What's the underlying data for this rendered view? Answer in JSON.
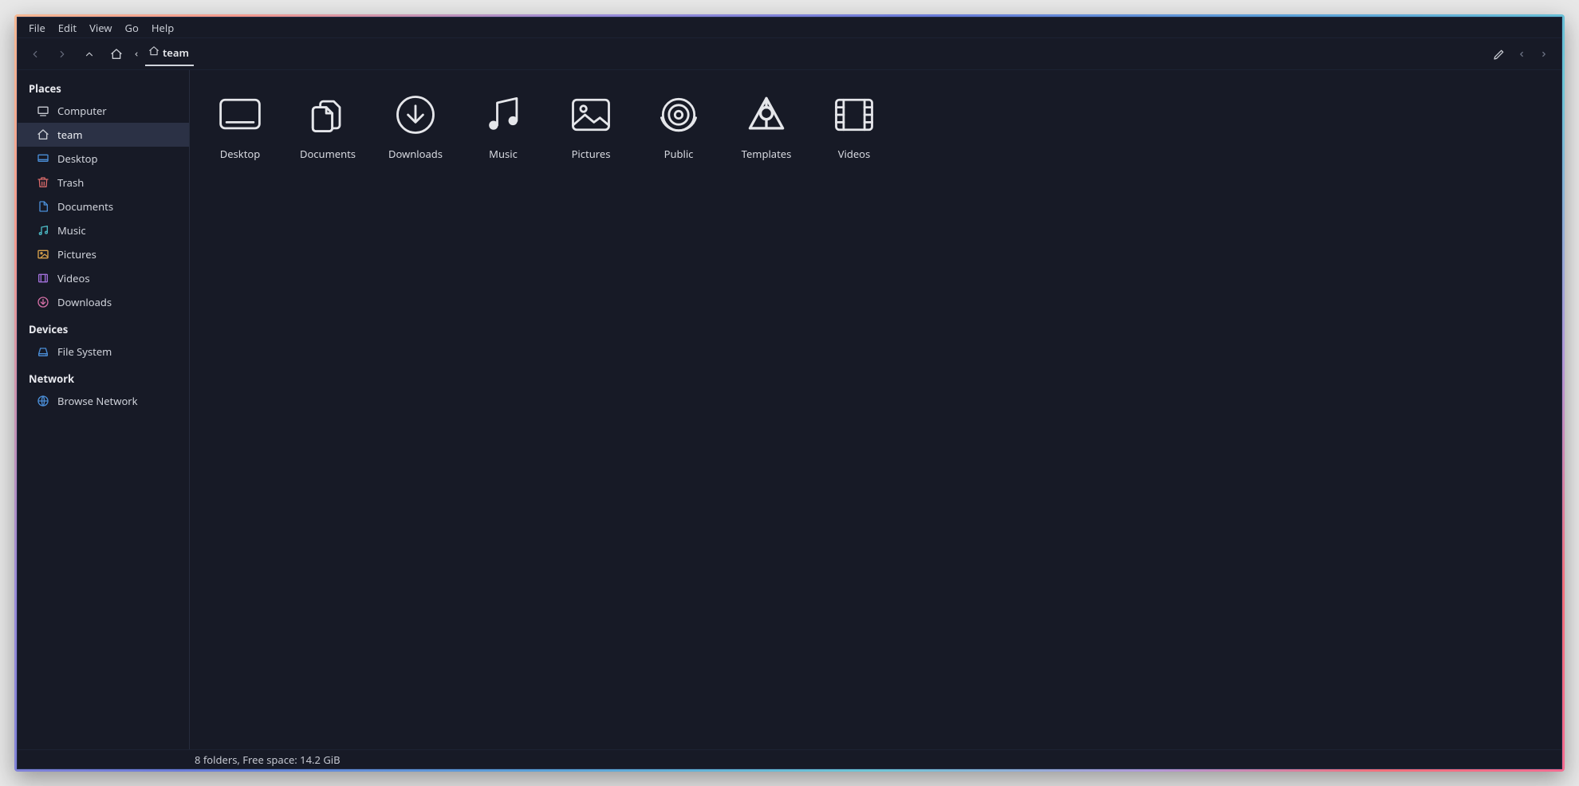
{
  "menubar": {
    "items": [
      "File",
      "Edit",
      "View",
      "Go",
      "Help"
    ]
  },
  "toolbar": {
    "breadcrumb_label": "team"
  },
  "sidebar": {
    "sections": [
      {
        "title": "Places",
        "items": [
          {
            "label": "Computer",
            "icon": "monitor",
            "selected": false
          },
          {
            "label": "team",
            "icon": "home",
            "selected": true
          },
          {
            "label": "Desktop",
            "icon": "desktop",
            "selected": false
          },
          {
            "label": "Trash",
            "icon": "trash",
            "selected": false
          },
          {
            "label": "Documents",
            "icon": "documents",
            "selected": false
          },
          {
            "label": "Music",
            "icon": "music",
            "selected": false
          },
          {
            "label": "Pictures",
            "icon": "pictures",
            "selected": false
          },
          {
            "label": "Videos",
            "icon": "videos",
            "selected": false
          },
          {
            "label": "Downloads",
            "icon": "downloads",
            "selected": false
          }
        ]
      },
      {
        "title": "Devices",
        "items": [
          {
            "label": "File System",
            "icon": "disk",
            "selected": false
          }
        ]
      },
      {
        "title": "Network",
        "items": [
          {
            "label": "Browse Network",
            "icon": "network",
            "selected": false
          }
        ]
      }
    ]
  },
  "items": [
    {
      "label": "Desktop",
      "icon": "big-desktop"
    },
    {
      "label": "Documents",
      "icon": "big-documents"
    },
    {
      "label": "Downloads",
      "icon": "big-downloads"
    },
    {
      "label": "Music",
      "icon": "big-music"
    },
    {
      "label": "Pictures",
      "icon": "big-pictures"
    },
    {
      "label": "Public",
      "icon": "big-public"
    },
    {
      "label": "Templates",
      "icon": "big-templates"
    },
    {
      "label": "Videos",
      "icon": "big-videos"
    }
  ],
  "statusbar": {
    "text": "8 folders, Free space: 14.2 GiB"
  }
}
